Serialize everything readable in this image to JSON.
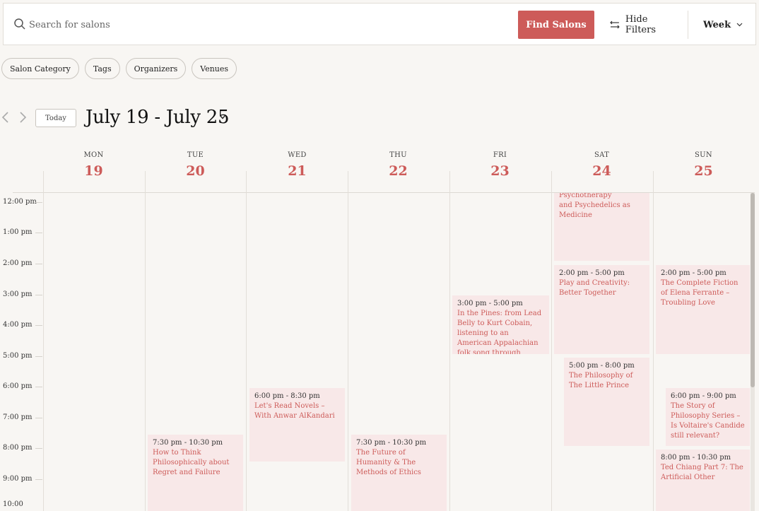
{
  "search": {
    "placeholder": "Search for salons",
    "value": ""
  },
  "toolbar": {
    "find_label": "Find Salons",
    "hide_filters_label": "Hide Filters",
    "view_label": "Week"
  },
  "filters": [
    "Salon Category",
    "Tags",
    "Organizers",
    "Venues"
  ],
  "nav": {
    "today_label": "Today",
    "range_title": "July 19 - July 25"
  },
  "days": [
    {
      "dow": "MON",
      "num": "19"
    },
    {
      "dow": "TUE",
      "num": "20"
    },
    {
      "dow": "WED",
      "num": "21"
    },
    {
      "dow": "THU",
      "num": "22"
    },
    {
      "dow": "FRI",
      "num": "23"
    },
    {
      "dow": "SAT",
      "num": "24"
    },
    {
      "dow": "SUN",
      "num": "25"
    }
  ],
  "hours": [
    "12:00 pm",
    "1:00 pm",
    "2:00 pm",
    "3:00 pm",
    "4:00 pm",
    "5:00 pm",
    "6:00 pm",
    "7:00 pm",
    "8:00 pm",
    "9:00 pm",
    "10:00"
  ],
  "events": [
    {
      "time": "",
      "title": "and Psychedelics as Medicine"
    },
    {
      "time": "3:00 pm - 5:00 pm",
      "title": "In the Pines: from Lead Belly to Kurt Cobain, listening to an American Appalachian folk song through"
    },
    {
      "time": "2:00 pm - 5:00 pm",
      "title": "Play and Creativity: Better Together"
    },
    {
      "time": "2:00 pm - 5:00 pm",
      "title": "The Complete Fiction of Elena Ferrante – Troubling Love"
    },
    {
      "time": "5:00 pm - 8:00 pm",
      "title": "The Philosophy of The Little Prince"
    },
    {
      "time": "6:00 pm - 8:30 pm",
      "title": "Let's Read Novels – With Anwar AlKandari"
    },
    {
      "time": "6:00 pm - 9:00 pm",
      "title": "The Story of Philosophy Series – Is Voltaire's Candide still relevant?"
    },
    {
      "time": "7:30 pm - 10:30 pm",
      "title": "How to Think Philosophically about Regret and Failure"
    },
    {
      "time": "7:30 pm - 10:30 pm",
      "title": "The Future of Humanity & The Methods of Ethics"
    },
    {
      "time": "8:00 pm - 10:30 pm",
      "title": "Ted Chiang Part 7: The Artificial Other"
    }
  ],
  "colors": {
    "accent": "#cd5b59",
    "event_bg": "#f8e8e8",
    "page_bg": "#f8f6f3"
  },
  "icons": {
    "search": "search-icon",
    "filters": "sliders-icon",
    "caret": "chevron-down-icon",
    "prev": "chevron-left-icon",
    "next": "chevron-right-icon"
  }
}
